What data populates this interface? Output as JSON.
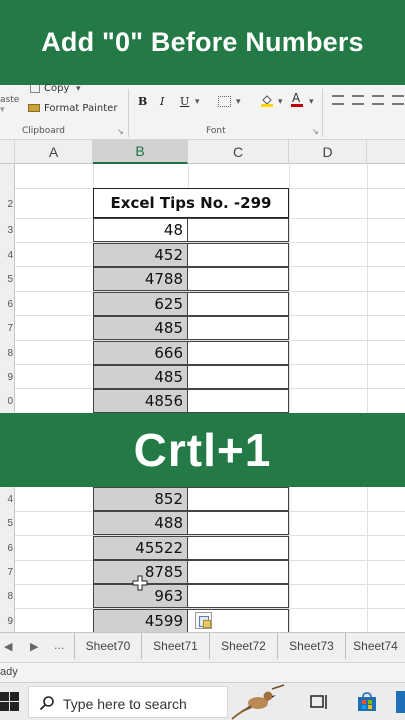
{
  "banner": {
    "title": "Add \"0\" Before Numbers"
  },
  "ribbon": {
    "copy": "Copy",
    "format_painter": "Format Painter",
    "clipboard": "Clipboard",
    "font": "Font",
    "bold": "B",
    "italic": "I",
    "underline": "U",
    "paste_partial": "aste",
    "font_color": "#c00000",
    "fill_color": "#ffd800"
  },
  "columns": [
    "A",
    "B",
    "C",
    "D"
  ],
  "rows": [
    "2",
    "3",
    "4",
    "5",
    "6",
    "7",
    "8",
    "9",
    "0",
    "4",
    "5",
    "6",
    "7",
    "8",
    "9"
  ],
  "sheet": {
    "title_cell": "Excel Tips No. -299",
    "values_top": [
      "48",
      "452",
      "4788",
      "625",
      "485",
      "666",
      "485",
      "4856"
    ],
    "values_bottom": [
      "852",
      "488",
      "45522",
      "8785",
      "963",
      "4599"
    ]
  },
  "overlay": {
    "text": "Crtl+1"
  },
  "tabs": {
    "ellipsis": "...",
    "sheets": [
      "Sheet70",
      "Sheet71",
      "Sheet72",
      "Sheet73",
      "Sheet74"
    ]
  },
  "status": {
    "text": "ady"
  },
  "taskbar": {
    "search_placeholder": "Type here to search"
  },
  "colors": {
    "banner": "#237a46",
    "selected_column": "#217346"
  }
}
